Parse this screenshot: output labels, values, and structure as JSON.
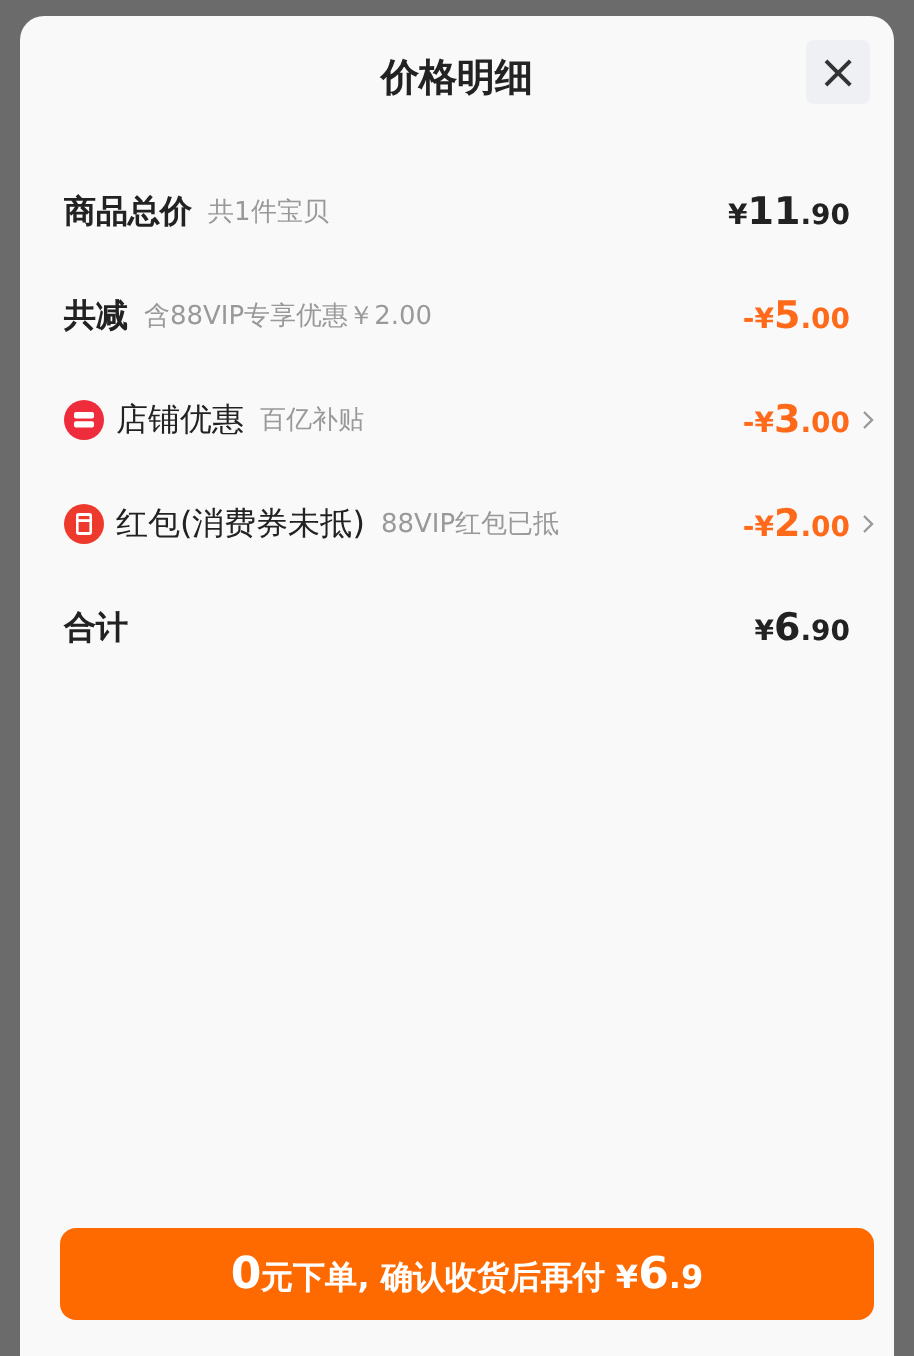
{
  "sheet": {
    "title": "价格明细",
    "close": "×"
  },
  "rows": [
    {
      "kind": "plain",
      "label": "商品总价",
      "note": "共1件宝贝",
      "color": "#222222",
      "price": {
        "currency": "¥",
        "integer": "11",
        "decimal": ".90"
      },
      "arrow": false
    },
    {
      "kind": "plain",
      "label": "共减",
      "note": "含88VIP专享优惠￥2.00",
      "color": "#ff6a1a",
      "price": {
        "sign": "-",
        "currency": "¥",
        "integer": "5",
        "decimal": ".00"
      },
      "arrow": false
    },
    {
      "kind": "shop",
      "label": "店铺优惠",
      "note": "百亿补贴",
      "color": "#ff6a1a",
      "price": {
        "sign": "-",
        "currency": "¥",
        "integer": "3",
        "decimal": ".00"
      },
      "arrow": true
    },
    {
      "kind": "redpacket",
      "label": "红包(消费券未抵)",
      "note": "88VIP红包已抵",
      "color": "#ff6a1a",
      "price": {
        "sign": "-",
        "currency": "¥",
        "integer": "2",
        "decimal": ".00"
      },
      "arrow": true
    },
    {
      "kind": "plain",
      "label": "合计",
      "color": "#222222",
      "price": {
        "currency": "¥",
        "integer": "6",
        "decimal": ".90"
      },
      "arrow": false
    }
  ],
  "submit": "**0**元下单, 确认收货后再付 ¥**6**.9"
}
